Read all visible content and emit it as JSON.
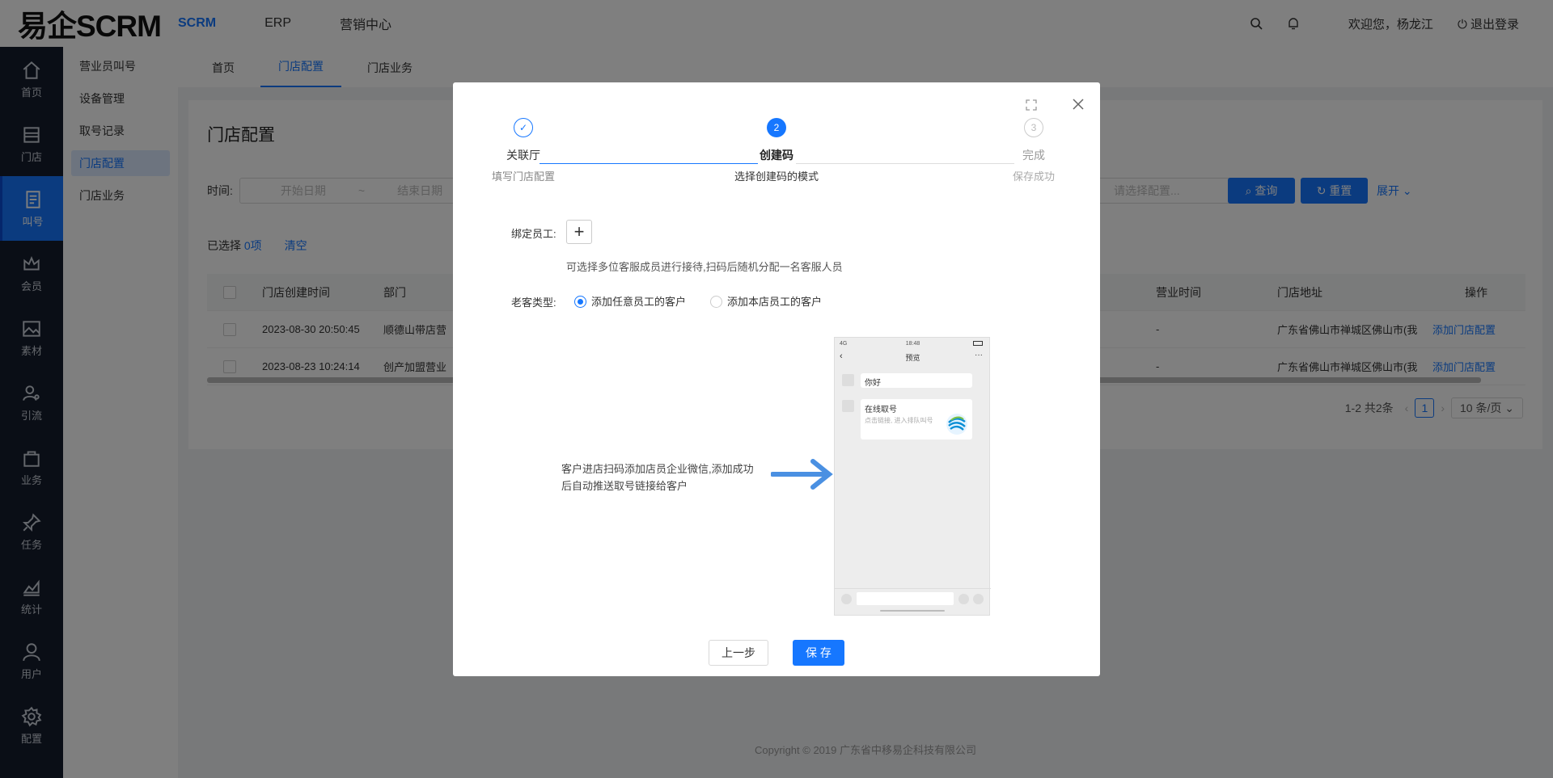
{
  "app": {
    "logo": "易企SCRM",
    "nav": [
      "SCRM",
      "ERP",
      "营销中心"
    ],
    "welcome": "欢迎您，杨龙江",
    "logout": "退出登录"
  },
  "sidebar": {
    "items": [
      {
        "label": "首页",
        "icon": "home-icon"
      },
      {
        "label": "门店",
        "icon": "store-icon"
      },
      {
        "label": "叫号",
        "icon": "queue-icon"
      },
      {
        "label": "会员",
        "icon": "crown-icon"
      },
      {
        "label": "素材",
        "icon": "image-icon"
      },
      {
        "label": "引流",
        "icon": "user-search-icon"
      },
      {
        "label": "业务",
        "icon": "bag-icon"
      },
      {
        "label": "任务",
        "icon": "pin-icon"
      },
      {
        "label": "统计",
        "icon": "chart-icon"
      },
      {
        "label": "用户",
        "icon": "user-icon"
      },
      {
        "label": "配置",
        "icon": "gear-icon"
      }
    ]
  },
  "subnav": [
    "营业员叫号",
    "设备管理",
    "取号记录",
    "门店配置",
    "门店业务"
  ],
  "tabs": [
    "首页",
    "门店配置",
    "门店业务"
  ],
  "page": {
    "title": "门店配置",
    "time_label": "时间:",
    "start_placeholder": "开始日期",
    "sep": "~",
    "end_placeholder": "结束日期",
    "select_placeholder": "请选择配置...",
    "query": "查询",
    "reset": "重置",
    "expand": "展开",
    "selected_prefix": "已选择 ",
    "selected_count": "0项",
    "clear": "清空",
    "columns": {
      "created": "门店创建时间",
      "dept": "部门",
      "hours": "营业时间",
      "address": "门店地址",
      "ops": "操作"
    },
    "rows": [
      {
        "created": "2023-08-30 20:50:45",
        "dept": "顺德山带店营",
        "hours": "-",
        "address": "广东省佛山市禅城区佛山市(我",
        "op": "添加门店配置"
      },
      {
        "created": "2023-08-23 10:24:14",
        "dept": "创产加盟营业",
        "hours": "-",
        "address": "广东省佛山市禅城区佛山市(我",
        "op": "添加门店配置"
      }
    ],
    "pager": {
      "total": "1-2 共2条",
      "page": "1",
      "size": "10 条/页"
    }
  },
  "copyright": "Copyright © 2019 广东省中移易企科技有限公司",
  "modal": {
    "steps": [
      {
        "num": "✓",
        "title": "关联厅",
        "desc": "填写门店配置"
      },
      {
        "num": "2",
        "title": "创建码",
        "desc": "选择创建码的模式"
      },
      {
        "num": "3",
        "title": "完成",
        "desc": "保存成功"
      }
    ],
    "bind_label": "绑定员工:",
    "bind_hint": "可选择多位客服成员进行接待,扫码后随机分配一名客服人员",
    "type_label": "老客类型:",
    "opt1": "添加任意员工的客户",
    "opt2": "添加本店员工的客户",
    "explain_line1": "客户进店扫码添加店员企业微信,添加成功",
    "explain_line2": "后自动推送取号链接给客户",
    "phone": {
      "signal": "4G",
      "time": "18:48",
      "title": "预览",
      "msg1": "你好",
      "msg2_title": "在线取号",
      "msg2_sub": "点击链接, 进入排队叫号"
    },
    "prev": "上一步",
    "save": "保 存"
  },
  "colors": {
    "primary": "#1677ff",
    "sidebar_bg": "#141d2c"
  }
}
